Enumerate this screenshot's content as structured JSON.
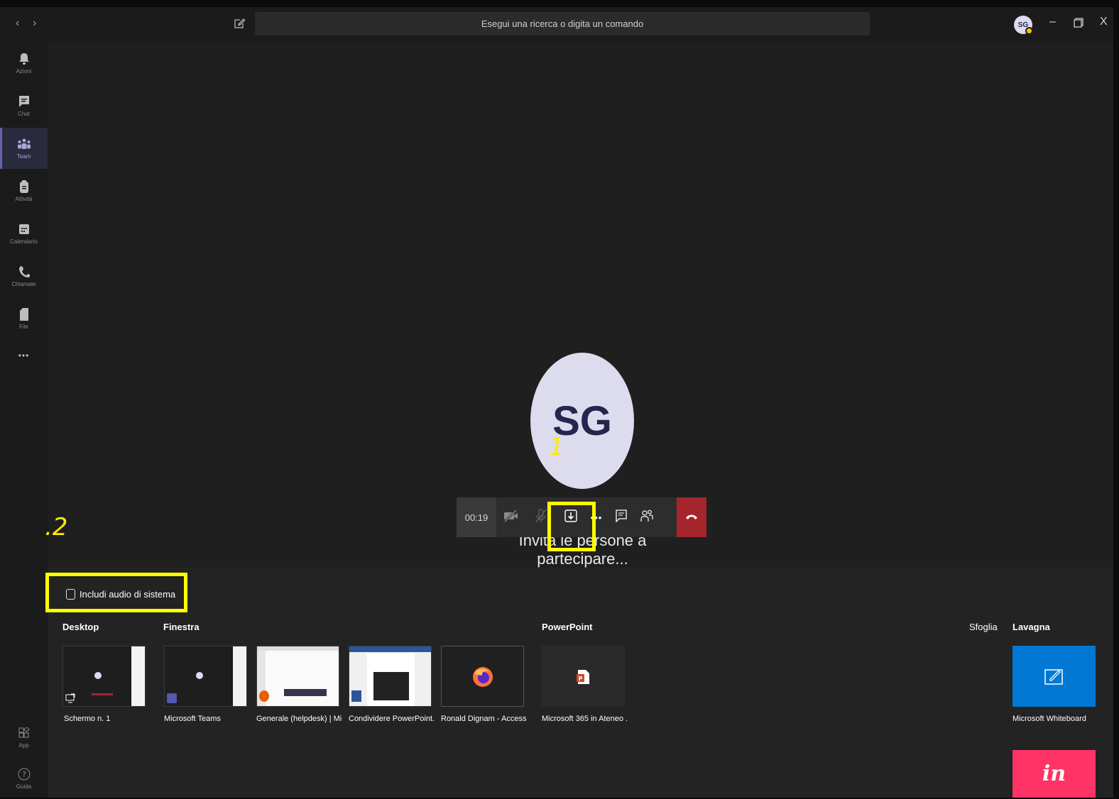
{
  "titlebar": {
    "back": "‹",
    "forward": "›",
    "search_placeholder": "Esegui una ricerca o digita un comando",
    "avatar_initials": "SG",
    "minimize": "–",
    "close": "X"
  },
  "rail": {
    "items": [
      {
        "label": "Azioni",
        "icon": "bell-icon"
      },
      {
        "label": "Chat",
        "icon": "chat-icon"
      },
      {
        "label": "Team",
        "icon": "teams-icon",
        "active": true
      },
      {
        "label": "Attività",
        "icon": "assignments-icon"
      },
      {
        "label": "Calendario",
        "icon": "calendar-icon"
      },
      {
        "label": "Chiamate",
        "icon": "phone-icon"
      },
      {
        "label": "File",
        "icon": "file-icon"
      }
    ],
    "more": "•••",
    "bottom": [
      {
        "label": "App",
        "icon": "apps-icon"
      },
      {
        "label": "Guida",
        "icon": "help-icon"
      }
    ]
  },
  "call": {
    "avatar_initials": "SG",
    "timer": "00:19",
    "invite_text": "Invita le persone a partecipare...",
    "more": "•••"
  },
  "annotations": {
    "one": "1",
    "two": ".2"
  },
  "tray": {
    "include_audio": "Includi audio di sistema",
    "headers": {
      "desktop": "Desktop",
      "window": "Finestra",
      "powerpoint": "PowerPoint",
      "browse": "Sfoglia",
      "whiteboard": "Lavagna"
    },
    "desktop_items": [
      {
        "label": "Schermo n. 1"
      }
    ],
    "window_items": [
      {
        "label": "Microsoft Teams"
      },
      {
        "label": "Generale (helpdesk) | Mic..."
      },
      {
        "label": "Condividere PowerPoint...."
      },
      {
        "label": "Ronald Dignam - Accessi ..."
      }
    ],
    "powerpoint_items": [
      {
        "label": "Microsoft 365 in Ateneo ..."
      }
    ],
    "whiteboard_items": [
      {
        "label": "Microsoft Whiteboard"
      },
      {
        "label": "in"
      }
    ]
  },
  "colors": {
    "accent": "#6264a7",
    "hangup": "#a4262c",
    "highlight": "#ffff00",
    "whiteboard": "#0078d4",
    "invision": "#ff3366"
  }
}
